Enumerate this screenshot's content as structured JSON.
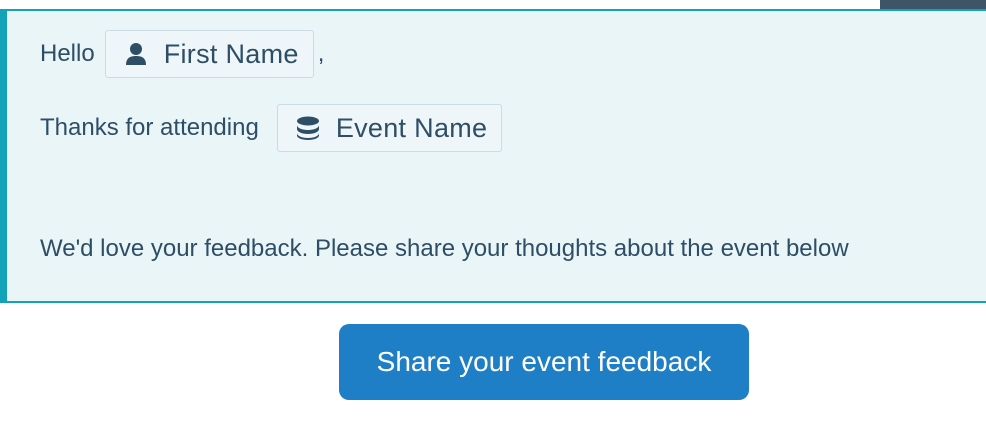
{
  "email": {
    "greeting": "Hello",
    "first_name_token": {
      "label": "First Name",
      "icon": "user-icon"
    },
    "comma": ",",
    "thanks_text": "Thanks for attending",
    "event_name_token": {
      "label": "Event Name",
      "icon": "database-icon"
    },
    "feedback_text": "We'd love your feedback. Please share your thoughts about the event below"
  },
  "cta": {
    "label": "Share your event feedback"
  },
  "colors": {
    "accent_border": "#13a3b8",
    "panel_background": "#eaf5f8",
    "text": "#2e4e66",
    "button": "#1f7fc6",
    "corner_tab": "#3e5568"
  }
}
